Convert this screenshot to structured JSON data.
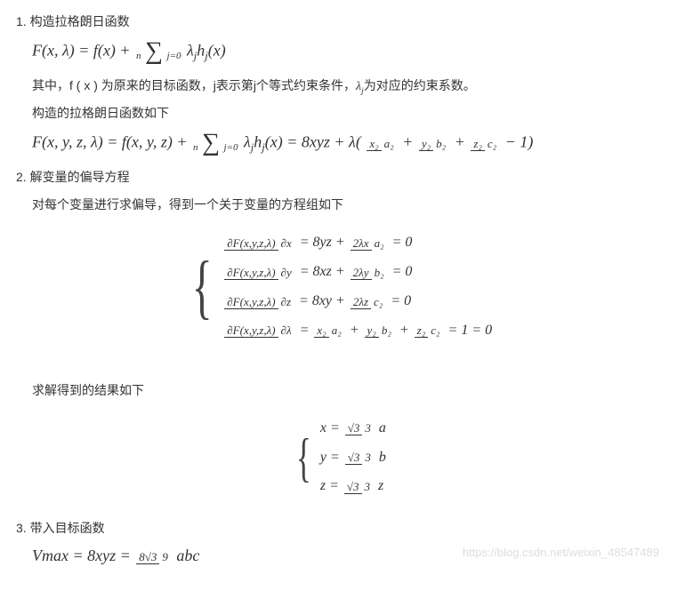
{
  "sections": {
    "s1": {
      "title": "1. 构造拉格朗日函数",
      "eq1_lhs": "F(x, λ) = f(x) + ",
      "eq1_sum_top": "n",
      "eq1_sum_bot": "j=0",
      "eq1_rhs": " λ",
      "eq1_sub1": "j",
      "eq1_h": "h",
      "eq1_sub2": "j",
      "eq1_tail": "(x)",
      "text1_a": "其中，f ( x ) 为原来的目标函数，j表示第j个等式约束条件，",
      "text1_b": "λ",
      "text1_b_sub": "j",
      "text1_c": "为对应的约束系数。",
      "text2": "构造的拉格朗日函数如下",
      "eq2_a": "F(x, y, z, λ) = f(x, y, z) + ",
      "eq2_sum_top": "n",
      "eq2_sum_bot": "j=0",
      "eq2_b": " λ",
      "eq2_b_sub": "j",
      "eq2_c": "h",
      "eq2_c_sub": "j",
      "eq2_d": "(x) = 8xyz + λ(",
      "eq2_f1n": "x₂",
      "eq2_f1d": "a₂",
      "eq2_plus1": " + ",
      "eq2_f2n": "y₂",
      "eq2_f2d": "b₂",
      "eq2_plus2": " + ",
      "eq2_f3n": "z₂",
      "eq2_f3d": "c₂",
      "eq2_tail": " − 1)"
    },
    "s2": {
      "title": "2. 解变量的偏导方程",
      "text1": "对每个变量进行求偏导，得到一个关于变量的方程组如下",
      "sys": {
        "l1_pn": "∂F(x,y,z,λ)",
        "l1_pd": "∂x",
        "l1_m": " = 8yz + ",
        "l1_fn": "2λx",
        "l1_fd": "a₂",
        "l1_e": " = 0",
        "l2_pn": "∂F(x,y,z,λ)",
        "l2_pd": "∂y",
        "l2_m": " = 8xz + ",
        "l2_fn": "2λy",
        "l2_fd": "b₂",
        "l2_e": " = 0",
        "l3_pn": "∂F(x,y,z,λ)",
        "l3_pd": "∂z",
        "l3_m": " = 8xy + ",
        "l3_fn": "2λz",
        "l3_fd": "c₂",
        "l3_e": " = 0",
        "l4_pn": "∂F(x,y,z,λ)",
        "l4_pd": "∂λ",
        "l4_m": " = ",
        "l4_f1n": "x₂",
        "l4_f1d": "a₂",
        "l4_p1": " + ",
        "l4_f2n": "y₂",
        "l4_f2d": "b₂",
        "l4_p2": " + ",
        "l4_f3n": "z₂",
        "l4_f3d": "c₂",
        "l4_e": " = 1 = 0"
      },
      "text2": "求解得到的结果如下",
      "sol": {
        "l1_v": "x = ",
        "l1_n": "√3",
        "l1_d": "3",
        "l1_t": "a",
        "l2_v": "y = ",
        "l2_n": "√3",
        "l2_d": "3",
        "l2_t": "b",
        "l3_v": "z = ",
        "l3_n": "√3",
        "l3_d": "3",
        "l3_t": "z"
      }
    },
    "s3": {
      "title": "3. 带入目标函数",
      "eq_a": "Vmax = 8xyz = ",
      "eq_fn": "8√3",
      "eq_fd": "9",
      "eq_t": "abc"
    }
  },
  "watermark": "https://blog.csdn.net/weixin_48547489"
}
